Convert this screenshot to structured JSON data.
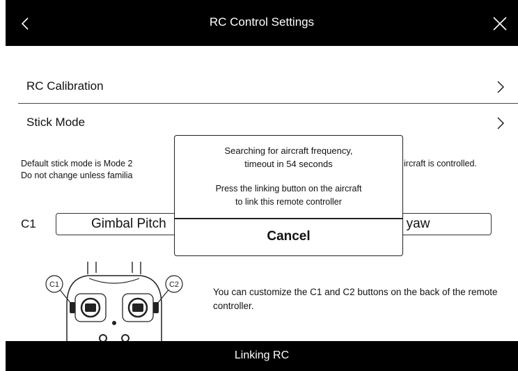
{
  "header": {
    "title": "RC Control Settings",
    "back_icon": "chevron-left-icon",
    "close_icon": "close-icon"
  },
  "menu": {
    "rc_calibration": "RC Calibration",
    "stick_mode": "Stick Mode"
  },
  "stick_note": {
    "line1_left": "Default stick mode is Mode 2",
    "line2_left": "Do not change unless familia",
    "line1_right": "ircraft is controlled."
  },
  "buttons_config": {
    "c1_label": "C1",
    "c1_value": "Gimbal Pitch",
    "c2_value": "bal yaw",
    "c1_badge": "C1",
    "c2_badge": "C2"
  },
  "customize_text": "You can customize the C1 and C2 buttons on the back of the remote controller.",
  "modal": {
    "line1": "Searching for aircraft frequency,",
    "line2": "timeout in 54 seconds",
    "line3": "Press the linking button on the aircraft",
    "line4": "to link this remote controller",
    "cancel": "Cancel"
  },
  "bottom_bar": {
    "label": "Linking RC"
  }
}
